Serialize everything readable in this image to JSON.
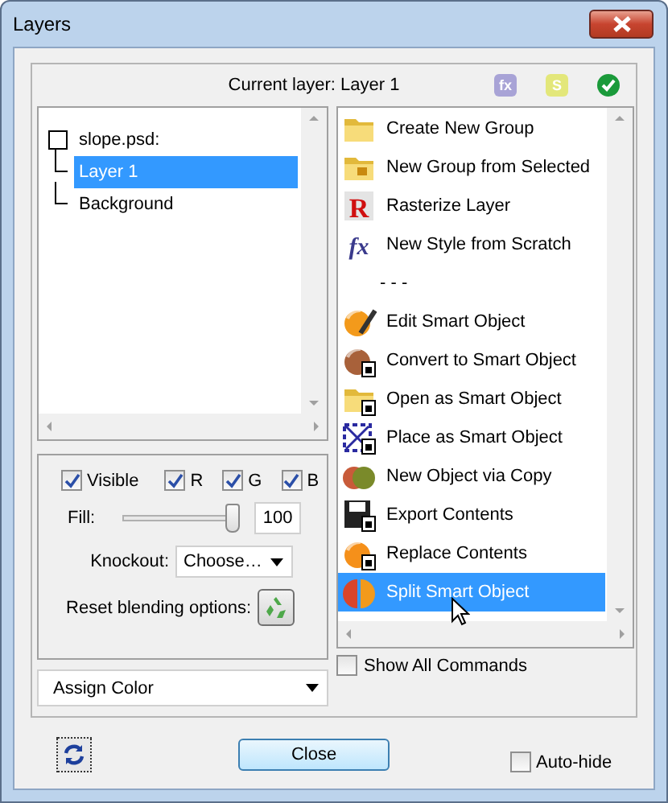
{
  "window": {
    "title": "Layers"
  },
  "header": {
    "current_layer": "Current layer: Layer 1",
    "badges": [
      {
        "text": "fx",
        "color": "#a8a3d6"
      },
      {
        "text": "S",
        "color": "#e3e77a"
      }
    ]
  },
  "layers_tree": [
    {
      "label": "slope.psd:",
      "selected": false,
      "children": [
        {
          "label": "Layer 1",
          "selected": true
        },
        {
          "label": "Background",
          "selected": false
        }
      ]
    }
  ],
  "channels": [
    {
      "label": "Visible",
      "checked": true
    },
    {
      "label": "R",
      "checked": true
    },
    {
      "label": "G",
      "checked": true
    },
    {
      "label": "B",
      "checked": true
    }
  ],
  "fill": {
    "label": "Fill:",
    "level": 1,
    "value": "100"
  },
  "knockout": {
    "label": "Knockout:",
    "value": "Choose…"
  },
  "reset": {
    "label": "Reset blending options:"
  },
  "color_dropdown": {
    "value": "Assign Color"
  },
  "commands": [
    {
      "kind": "command",
      "label": "Create New Group",
      "selected": false
    },
    {
      "kind": "command",
      "label": "New Group from Selected",
      "selected": false
    },
    {
      "kind": "command",
      "glyph": "R",
      "label": "Rasterize Layer",
      "selected": false
    },
    {
      "kind": "command",
      "glyph": "fx",
      "label": "New Style from Scratch",
      "selected": false
    },
    {
      "kind": "separator",
      "label": "- - -",
      "selected": false
    },
    {
      "kind": "command",
      "label": "Edit Smart Object",
      "selected": false
    },
    {
      "kind": "command",
      "label": "Convert to Smart Object",
      "selected": false
    },
    {
      "kind": "command",
      "label": "Open as Smart Object",
      "selected": false
    },
    {
      "kind": "command",
      "label": "Place as Smart Object",
      "selected": false
    },
    {
      "kind": "command",
      "label": "New Object via Copy",
      "selected": false
    },
    {
      "kind": "command",
      "label": "Export Contents",
      "selected": false
    },
    {
      "kind": "command",
      "label": "Replace Contents",
      "selected": false
    },
    {
      "kind": "command",
      "label": "Split Smart Object",
      "selected": true
    }
  ],
  "show_all_commands": {
    "label": "Show All Commands",
    "checked": false
  },
  "close_button": "Close",
  "auto_hide": {
    "label": "Auto-hide",
    "checked": false
  }
}
